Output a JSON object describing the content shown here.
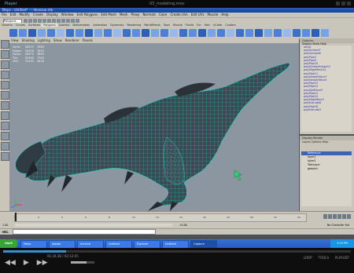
{
  "player": {
    "title": "03_modeling.mov",
    "logo": "Player",
    "time_display": "01:24:36 / 02:12:05",
    "progress": 0.18,
    "volume": 0.66,
    "options": [
      "LOOP",
      "TOOLS",
      "PLAYLIST"
    ]
  },
  "maya": {
    "title": "Maya - Untitled* --- dinosaur.mb",
    "menus": [
      "File",
      "Edit",
      "Modify",
      "Create",
      "Display",
      "Window",
      "Edit Polygons",
      "Edit Mesh",
      "Mesh",
      "Proxy",
      "Normals",
      "Color",
      "Create UVs",
      "Edit UVs",
      "Muscle",
      "Help"
    ],
    "selector": "Polygons",
    "shelf_tabs": [
      "General",
      "Curves",
      "Surfaces",
      "Polygons",
      "Subdivs",
      "Deformation",
      "Animation",
      "Dynamics",
      "Rendering",
      "PaintEffects",
      "Toon",
      "Muscle",
      "Fluids",
      "Fur",
      "Hair",
      "nCloth",
      "Custom"
    ],
    "active_shelf": "Polygons",
    "viewport_menu": [
      "View",
      "Shading",
      "Lighting",
      "Show",
      "Renderer",
      "Panels"
    ],
    "poly_hud": [
      {
        "label": "Verts:",
        "v1": "26575",
        "v2": "3980"
      },
      {
        "label": "Edges:",
        "v1": "53018",
        "v2": "7835"
      },
      {
        "label": "Faces:",
        "v1": "26470",
        "v2": "3850"
      },
      {
        "label": "Tris:",
        "v1": "52940",
        "v2": "7700"
      },
      {
        "label": "UVs:",
        "v1": "31442",
        "v2": "4518"
      }
    ],
    "outliner": {
      "title": "Outliner",
      "menu": "Display  Show  Help",
      "items": [
        "persp",
        "polySurface7",
        "polySurface8",
        "polyPipe3",
        "polyPipe9",
        "polyPipe10",
        "polySurfaceShape12",
        "polyEdgeMesh14",
        "polyPipe11",
        "polySmoothFace3",
        "polySmoothFace4",
        "polyPipe12",
        "polyPipe13",
        "polySplitFace5",
        "polyPipe14",
        "polyPipe15",
        "polyEdgeMesh7",
        "polyExtrude8",
        "polyPipe16",
        "polyExtrude3"
      ]
    },
    "layers": {
      "title": "Display  Render",
      "menu": "Layers  Options  Help",
      "items": [
        "Reference",
        "layer1",
        "layer2",
        "TextLayer",
        "geoskin"
      ]
    },
    "timeline": {
      "ticks": [
        "1",
        "2",
        "4",
        "6",
        "8",
        "10",
        "12",
        "14",
        "16",
        "18",
        "20",
        "22",
        "24"
      ],
      "current_frame": "1.00"
    },
    "range": {
      "start": "1.00",
      "end": "24.00",
      "char_set": "No Character Set"
    },
    "mel_label": "MEL"
  },
  "taskbar": {
    "start": "start",
    "tasks": [
      "Maya",
      "Adobe",
      "Archive",
      "Untitled",
      "Explorer",
      "Untitled",
      "Capture"
    ],
    "active_task": 6,
    "clock": "3:24 PM"
  },
  "colors": {
    "mesh": "#3a4a52",
    "wire": "#2bd6c8",
    "viewport_bg": "#8c96a0",
    "accent": "#3a8fc7"
  }
}
